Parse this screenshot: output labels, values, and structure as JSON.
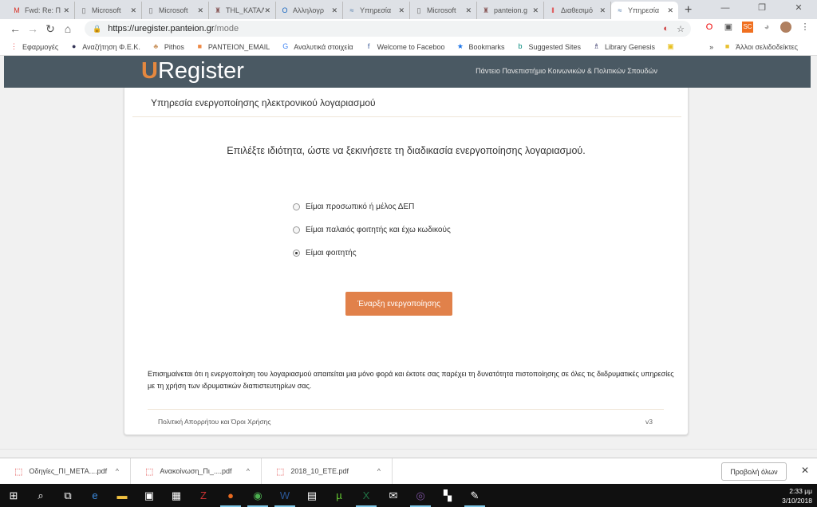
{
  "browser": {
    "tabs": [
      {
        "title": "Fwd: Re: Π",
        "icon": "gmail-icon",
        "glyph": "M",
        "color": "#d93025"
      },
      {
        "title": "Microsoft",
        "icon": "page-icon",
        "glyph": "▯",
        "color": "#666"
      },
      {
        "title": "Microsoft",
        "icon": "page-icon",
        "glyph": "▯",
        "color": "#666"
      },
      {
        "title": "THL_KATAΛ",
        "icon": "panteion-icon",
        "glyph": "♜",
        "color": "#8a5a5a"
      },
      {
        "title": "Αλληλογρ",
        "icon": "outlook-icon",
        "glyph": "O",
        "color": "#1565c0"
      },
      {
        "title": "Υπηρεσία",
        "icon": "uregister-icon",
        "glyph": "≈",
        "color": "#4a76a8"
      },
      {
        "title": "Microsoft",
        "icon": "page-icon",
        "glyph": "▯",
        "color": "#666"
      },
      {
        "title": "panteion.g",
        "icon": "panteion-icon",
        "glyph": "♜",
        "color": "#8a5a5a"
      },
      {
        "title": "Διαθεσιμό",
        "icon": "red-bars-icon",
        "glyph": "‖",
        "color": "#e02020"
      },
      {
        "title": "Υπηρεσία",
        "icon": "uregister-icon",
        "glyph": "≈",
        "color": "#4a76a8",
        "active": true
      }
    ],
    "url_host": "https://uregister.panteion.gr",
    "url_path": "/mode",
    "bookmarks": [
      {
        "label": "Εφαρμογές",
        "icon": "apps-icon",
        "glyph": "⋮",
        "color": "#e44"
      },
      {
        "label": "Αναζήτηση Φ.Ε.Κ.",
        "icon": "globe-icon",
        "glyph": "●",
        "color": "#335"
      },
      {
        "label": "Pithos",
        "icon": "pithos-icon",
        "glyph": "♣",
        "color": "#c96"
      },
      {
        "label": "PANTEION_EMAIL",
        "icon": "windows-icon",
        "glyph": "■",
        "color": "#e84"
      },
      {
        "label": "Αναλυτικά στοιχεία",
        "icon": "google-icon",
        "glyph": "G",
        "color": "#4285f4"
      },
      {
        "label": "Welcome to Faceboo",
        "icon": "facebook-icon",
        "glyph": "f",
        "color": "#3b5998"
      },
      {
        "label": "Bookmarks",
        "icon": "star-icon",
        "glyph": "★",
        "color": "#1a73e8"
      },
      {
        "label": "Suggested Sites",
        "icon": "bing-icon",
        "glyph": "b",
        "color": "#00897b"
      },
      {
        "label": "Library Genesis",
        "icon": "libgen-icon",
        "glyph": "♗",
        "color": "#336"
      },
      {
        "label": "",
        "icon": "yellow-bookmark-icon",
        "glyph": "▣",
        "color": "#e8c020"
      }
    ],
    "other_bookmarks": "Άλλοι σελιδοδείκτες"
  },
  "page": {
    "logo_u": "U",
    "logo_rest": "Register",
    "university": "Πάντειο Πανεπιστήμιο Κοινωνικών & Πολιτικών Σπουδών",
    "card_title": "Υπηρεσία ενεργοποίησης ηλεκτρονικού λογαριασμού",
    "lead": "Επιλέξτε ιδιότητα, ώστε να ξεκινήσετε τη διαδικασία ενεργοποίησης λογαριασμού.",
    "options": [
      {
        "label": "Είμαι προσωπικό ή μέλος ΔΕΠ",
        "selected": false
      },
      {
        "label": "Είμαι παλαιός φοιτητής και έχω κωδικούς",
        "selected": false
      },
      {
        "label": "Είμαι φοιτητής",
        "selected": true
      }
    ],
    "start_button": "Έναρξη ενεργοποίησης",
    "notice": "Επισημαίνεται ότι η ενεργοποίηση του λογαριασμού απαιτείται μια μόνο φορά και έκτοτε σας παρέχει τη δυνατότητα πιστοποίησης σε όλες τις διιδρυματικές υπηρεσίες με τη χρήση των ιδρυματικών διαπιστευτηρίων σας.",
    "footer_link": "Πολιτική Απορρήτου και Όροι Χρήσης",
    "version": "v3",
    "accent": "#e1814a",
    "header_bg": "#4a5963"
  },
  "downloads": {
    "items": [
      "Οδηγίες_ΠΙ_ΜΕΤΑ....pdf",
      "Ανακοίνωση_Πι_....pdf",
      "2018_10_ETE.pdf"
    ],
    "show_all": "Προβολή όλων"
  },
  "taskbar": {
    "apps": [
      "start-icon",
      "search-icon",
      "task-view-icon",
      "edge-icon",
      "file-explorer-icon",
      "store-icon",
      "calculator-icon",
      "filezilla-icon",
      "firefox-icon",
      "chrome-icon",
      "word-icon",
      "photo-icon",
      "utorrent-icon",
      "excel-icon",
      "mail-icon",
      "viber-icon",
      "network-icon",
      "paint-icon"
    ],
    "time": "2:33 μμ",
    "date": "3/10/2018"
  }
}
